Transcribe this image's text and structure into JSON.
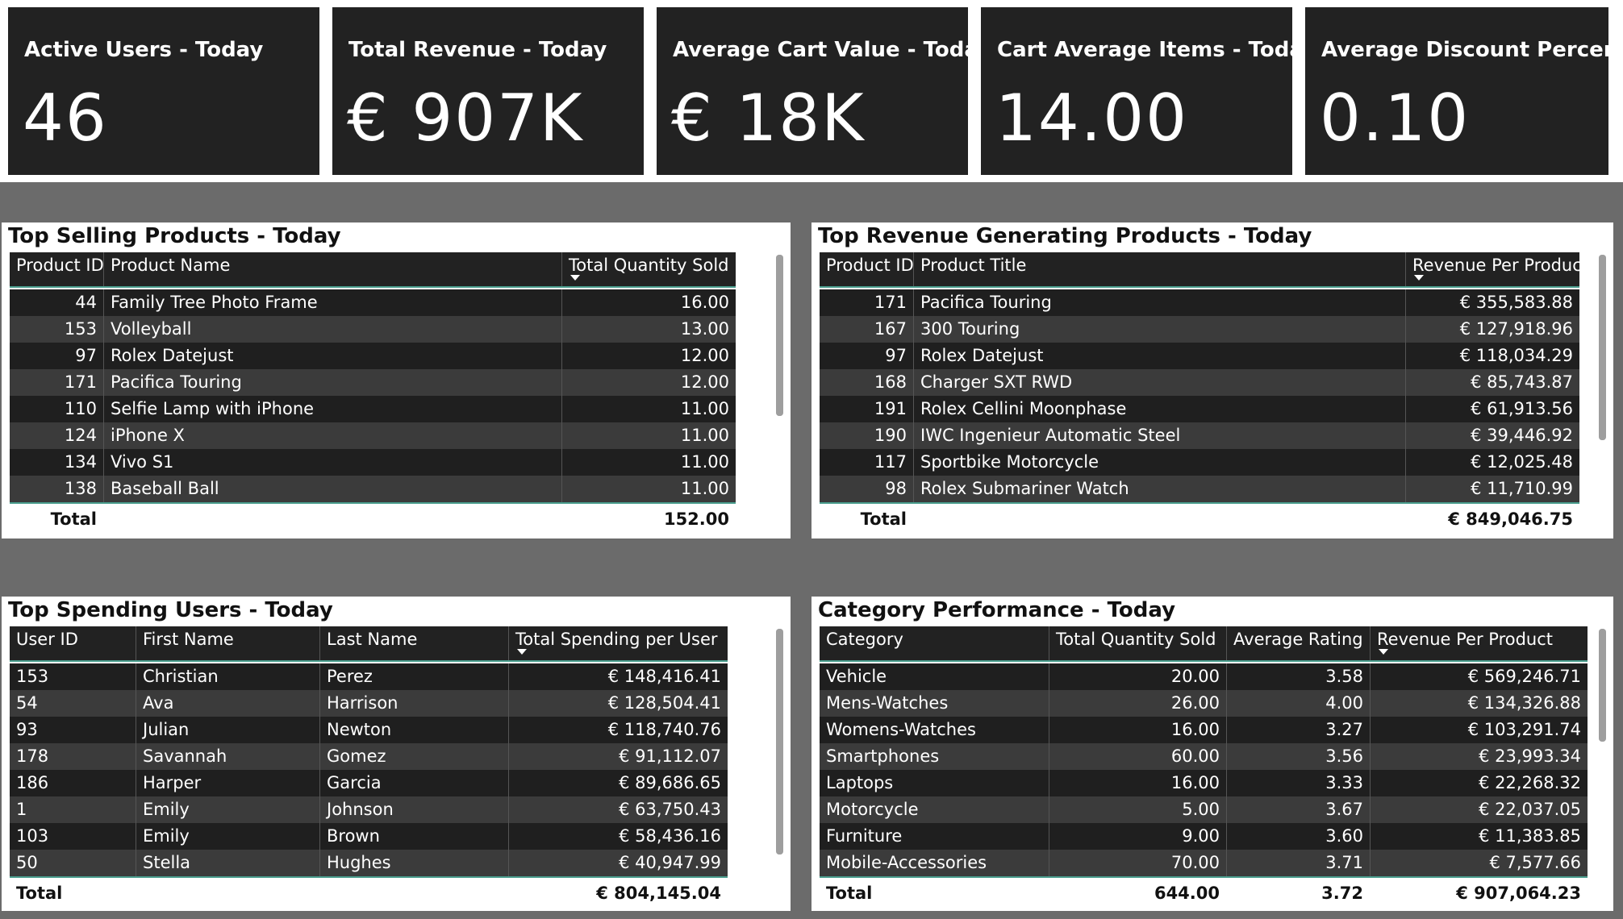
{
  "kpis": [
    {
      "title": "Active Users - Today",
      "value": "46"
    },
    {
      "title": "Total Revenue - Today",
      "value": "€ 907K"
    },
    {
      "title": "Average Cart Value - Today",
      "value": "€ 18K"
    },
    {
      "title": "Cart Average Items - Today",
      "value": "14.00"
    },
    {
      "title": "Average Discount Percent",
      "value": "0.10"
    }
  ],
  "top_selling": {
    "title": "Top Selling Products - Today",
    "headers": [
      "Product ID",
      "Product Name",
      "Total Quantity Sold"
    ],
    "rows": [
      [
        "44",
        "Family Tree Photo Frame",
        "16.00"
      ],
      [
        "153",
        "Volleyball",
        "13.00"
      ],
      [
        "97",
        "Rolex Datejust",
        "12.00"
      ],
      [
        "171",
        "Pacifica Touring",
        "12.00"
      ],
      [
        "110",
        "Selfie Lamp with iPhone",
        "11.00"
      ],
      [
        "124",
        "iPhone X",
        "11.00"
      ],
      [
        "134",
        "Vivo S1",
        "11.00"
      ],
      [
        "138",
        "Baseball Ball",
        "11.00"
      ]
    ],
    "total_label": "Total",
    "totals": [
      "152.00"
    ]
  },
  "top_revenue": {
    "title": "Top Revenue Generating Products - Today",
    "headers": [
      "Product ID",
      "Product Title",
      "Revenue Per Product"
    ],
    "rows": [
      [
        "171",
        "Pacifica Touring",
        "€ 355,583.88"
      ],
      [
        "167",
        "300 Touring",
        "€ 127,918.96"
      ],
      [
        "97",
        "Rolex Datejust",
        "€ 118,034.29"
      ],
      [
        "168",
        "Charger SXT RWD",
        "€ 85,743.87"
      ],
      [
        "191",
        "Rolex Cellini Moonphase",
        "€ 61,913.56"
      ],
      [
        "190",
        "IWC Ingenieur Automatic Steel",
        "€ 39,446.92"
      ],
      [
        "117",
        "Sportbike Motorcycle",
        "€ 12,025.48"
      ],
      [
        "98",
        "Rolex Submariner Watch",
        "€ 11,710.99"
      ]
    ],
    "total_label": "Total",
    "totals": [
      "€ 849,046.75"
    ]
  },
  "top_users": {
    "title": "Top Spending Users - Today",
    "headers": [
      "User ID",
      "First Name",
      "Last Name",
      "Total Spending per User"
    ],
    "rows": [
      [
        "153",
        "Christian",
        "Perez",
        "€ 148,416.41"
      ],
      [
        "54",
        "Ava",
        "Harrison",
        "€ 128,504.41"
      ],
      [
        "93",
        "Julian",
        "Newton",
        "€ 118,740.76"
      ],
      [
        "178",
        "Savannah",
        "Gomez",
        "€ 91,112.07"
      ],
      [
        "186",
        "Harper",
        "Garcia",
        "€ 89,686.65"
      ],
      [
        "1",
        "Emily",
        "Johnson",
        "€ 63,750.43"
      ],
      [
        "103",
        "Emily",
        "Brown",
        "€ 58,436.16"
      ],
      [
        "50",
        "Stella",
        "Hughes",
        "€ 40,947.99"
      ]
    ],
    "total_label": "Total",
    "totals": [
      "€ 804,145.04"
    ]
  },
  "category": {
    "title": "Category Performance - Today",
    "headers": [
      "Category",
      "Total Quantity Sold",
      "Average Rating",
      "Revenue Per Product"
    ],
    "rows": [
      [
        "Vehicle",
        "20.00",
        "3.58",
        "€ 569,246.71"
      ],
      [
        "Mens-Watches",
        "26.00",
        "4.00",
        "€ 134,326.88"
      ],
      [
        "Womens-Watches",
        "16.00",
        "3.27",
        "€ 103,291.74"
      ],
      [
        "Smartphones",
        "60.00",
        "3.56",
        "€ 23,993.34"
      ],
      [
        "Laptops",
        "16.00",
        "3.33",
        "€ 22,268.32"
      ],
      [
        "Motorcycle",
        "5.00",
        "3.67",
        "€ 22,037.05"
      ],
      [
        "Furniture",
        "9.00",
        "3.60",
        "€ 11,383.85"
      ],
      [
        "Mobile-Accessories",
        "70.00",
        "3.71",
        "€ 7,577.66"
      ]
    ],
    "total_label": "Total",
    "totals": [
      "644.00",
      "3.72",
      "€ 907,064.23"
    ]
  }
}
